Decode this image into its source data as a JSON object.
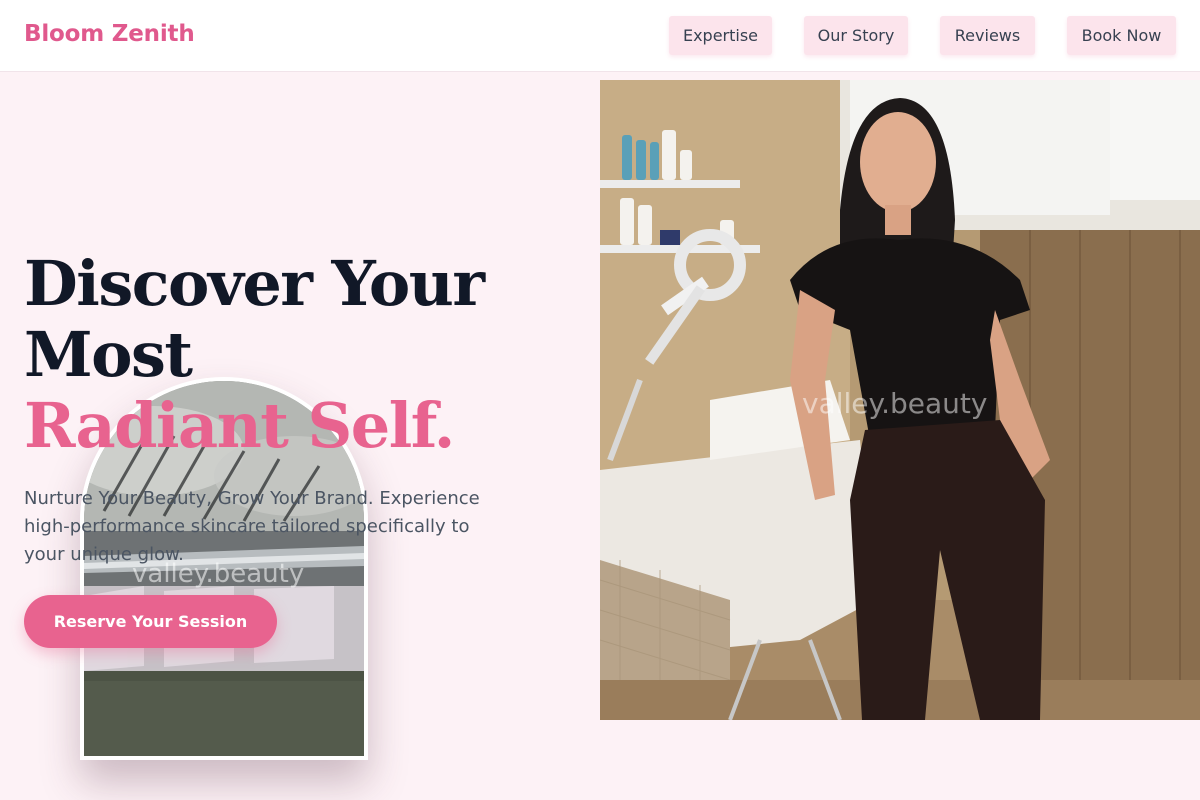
{
  "brand": {
    "name": "Bloom Zenith"
  },
  "nav": {
    "items": [
      {
        "label": "Expertise"
      },
      {
        "label": "Our Story"
      },
      {
        "label": "Reviews"
      },
      {
        "label": "Book Now"
      }
    ]
  },
  "hero": {
    "headline_line1": "Discover Your",
    "headline_line2": "Most",
    "headline_accent": "Radiant Self.",
    "subtext": "Nurture Your Beauty, Grow Your Brand. Experience high-performance skincare tailored specifically to your unique glow.",
    "cta_label": "Reserve Your Session"
  },
  "images": {
    "arch_watermark": "valley.beauty",
    "hero_watermark": "valley.beauty"
  },
  "colors": {
    "accent": "#e8638f",
    "page_background": "#fdf2f6",
    "nav_button": "#fce4ec",
    "heading": "#111827"
  }
}
